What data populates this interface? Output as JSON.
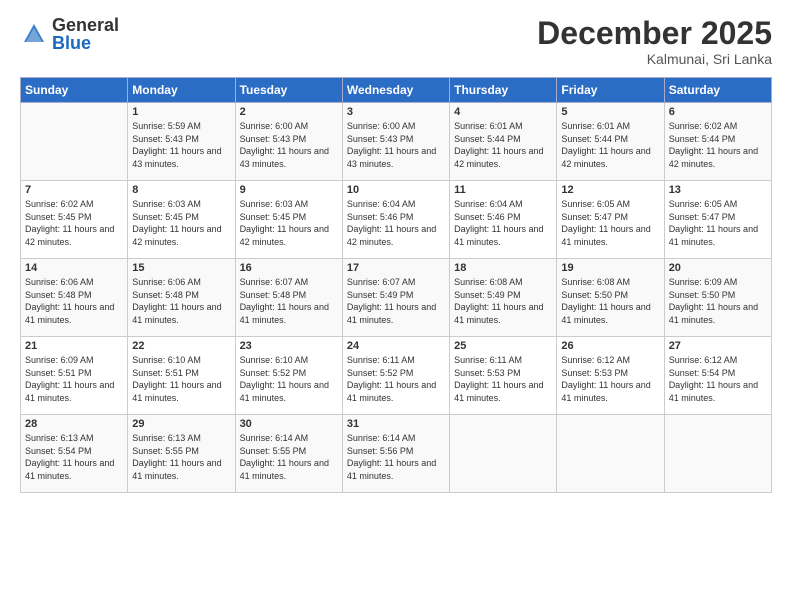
{
  "header": {
    "logo_general": "General",
    "logo_blue": "Blue",
    "month_title": "December 2025",
    "location": "Kalmunai, Sri Lanka"
  },
  "days_of_week": [
    "Sunday",
    "Monday",
    "Tuesday",
    "Wednesday",
    "Thursday",
    "Friday",
    "Saturday"
  ],
  "weeks": [
    [
      {
        "day": "",
        "sunrise": "",
        "sunset": "",
        "daylight": ""
      },
      {
        "day": "1",
        "sunrise": "Sunrise: 5:59 AM",
        "sunset": "Sunset: 5:43 PM",
        "daylight": "Daylight: 11 hours and 43 minutes."
      },
      {
        "day": "2",
        "sunrise": "Sunrise: 6:00 AM",
        "sunset": "Sunset: 5:43 PM",
        "daylight": "Daylight: 11 hours and 43 minutes."
      },
      {
        "day": "3",
        "sunrise": "Sunrise: 6:00 AM",
        "sunset": "Sunset: 5:43 PM",
        "daylight": "Daylight: 11 hours and 43 minutes."
      },
      {
        "day": "4",
        "sunrise": "Sunrise: 6:01 AM",
        "sunset": "Sunset: 5:44 PM",
        "daylight": "Daylight: 11 hours and 42 minutes."
      },
      {
        "day": "5",
        "sunrise": "Sunrise: 6:01 AM",
        "sunset": "Sunset: 5:44 PM",
        "daylight": "Daylight: 11 hours and 42 minutes."
      },
      {
        "day": "6",
        "sunrise": "Sunrise: 6:02 AM",
        "sunset": "Sunset: 5:44 PM",
        "daylight": "Daylight: 11 hours and 42 minutes."
      }
    ],
    [
      {
        "day": "7",
        "sunrise": "Sunrise: 6:02 AM",
        "sunset": "Sunset: 5:45 PM",
        "daylight": "Daylight: 11 hours and 42 minutes."
      },
      {
        "day": "8",
        "sunrise": "Sunrise: 6:03 AM",
        "sunset": "Sunset: 5:45 PM",
        "daylight": "Daylight: 11 hours and 42 minutes."
      },
      {
        "day": "9",
        "sunrise": "Sunrise: 6:03 AM",
        "sunset": "Sunset: 5:45 PM",
        "daylight": "Daylight: 11 hours and 42 minutes."
      },
      {
        "day": "10",
        "sunrise": "Sunrise: 6:04 AM",
        "sunset": "Sunset: 5:46 PM",
        "daylight": "Daylight: 11 hours and 42 minutes."
      },
      {
        "day": "11",
        "sunrise": "Sunrise: 6:04 AM",
        "sunset": "Sunset: 5:46 PM",
        "daylight": "Daylight: 11 hours and 41 minutes."
      },
      {
        "day": "12",
        "sunrise": "Sunrise: 6:05 AM",
        "sunset": "Sunset: 5:47 PM",
        "daylight": "Daylight: 11 hours and 41 minutes."
      },
      {
        "day": "13",
        "sunrise": "Sunrise: 6:05 AM",
        "sunset": "Sunset: 5:47 PM",
        "daylight": "Daylight: 11 hours and 41 minutes."
      }
    ],
    [
      {
        "day": "14",
        "sunrise": "Sunrise: 6:06 AM",
        "sunset": "Sunset: 5:48 PM",
        "daylight": "Daylight: 11 hours and 41 minutes."
      },
      {
        "day": "15",
        "sunrise": "Sunrise: 6:06 AM",
        "sunset": "Sunset: 5:48 PM",
        "daylight": "Daylight: 11 hours and 41 minutes."
      },
      {
        "day": "16",
        "sunrise": "Sunrise: 6:07 AM",
        "sunset": "Sunset: 5:48 PM",
        "daylight": "Daylight: 11 hours and 41 minutes."
      },
      {
        "day": "17",
        "sunrise": "Sunrise: 6:07 AM",
        "sunset": "Sunset: 5:49 PM",
        "daylight": "Daylight: 11 hours and 41 minutes."
      },
      {
        "day": "18",
        "sunrise": "Sunrise: 6:08 AM",
        "sunset": "Sunset: 5:49 PM",
        "daylight": "Daylight: 11 hours and 41 minutes."
      },
      {
        "day": "19",
        "sunrise": "Sunrise: 6:08 AM",
        "sunset": "Sunset: 5:50 PM",
        "daylight": "Daylight: 11 hours and 41 minutes."
      },
      {
        "day": "20",
        "sunrise": "Sunrise: 6:09 AM",
        "sunset": "Sunset: 5:50 PM",
        "daylight": "Daylight: 11 hours and 41 minutes."
      }
    ],
    [
      {
        "day": "21",
        "sunrise": "Sunrise: 6:09 AM",
        "sunset": "Sunset: 5:51 PM",
        "daylight": "Daylight: 11 hours and 41 minutes."
      },
      {
        "day": "22",
        "sunrise": "Sunrise: 6:10 AM",
        "sunset": "Sunset: 5:51 PM",
        "daylight": "Daylight: 11 hours and 41 minutes."
      },
      {
        "day": "23",
        "sunrise": "Sunrise: 6:10 AM",
        "sunset": "Sunset: 5:52 PM",
        "daylight": "Daylight: 11 hours and 41 minutes."
      },
      {
        "day": "24",
        "sunrise": "Sunrise: 6:11 AM",
        "sunset": "Sunset: 5:52 PM",
        "daylight": "Daylight: 11 hours and 41 minutes."
      },
      {
        "day": "25",
        "sunrise": "Sunrise: 6:11 AM",
        "sunset": "Sunset: 5:53 PM",
        "daylight": "Daylight: 11 hours and 41 minutes."
      },
      {
        "day": "26",
        "sunrise": "Sunrise: 6:12 AM",
        "sunset": "Sunset: 5:53 PM",
        "daylight": "Daylight: 11 hours and 41 minutes."
      },
      {
        "day": "27",
        "sunrise": "Sunrise: 6:12 AM",
        "sunset": "Sunset: 5:54 PM",
        "daylight": "Daylight: 11 hours and 41 minutes."
      }
    ],
    [
      {
        "day": "28",
        "sunrise": "Sunrise: 6:13 AM",
        "sunset": "Sunset: 5:54 PM",
        "daylight": "Daylight: 11 hours and 41 minutes."
      },
      {
        "day": "29",
        "sunrise": "Sunrise: 6:13 AM",
        "sunset": "Sunset: 5:55 PM",
        "daylight": "Daylight: 11 hours and 41 minutes."
      },
      {
        "day": "30",
        "sunrise": "Sunrise: 6:14 AM",
        "sunset": "Sunset: 5:55 PM",
        "daylight": "Daylight: 11 hours and 41 minutes."
      },
      {
        "day": "31",
        "sunrise": "Sunrise: 6:14 AM",
        "sunset": "Sunset: 5:56 PM",
        "daylight": "Daylight: 11 hours and 41 minutes."
      },
      {
        "day": "",
        "sunrise": "",
        "sunset": "",
        "daylight": ""
      },
      {
        "day": "",
        "sunrise": "",
        "sunset": "",
        "daylight": ""
      },
      {
        "day": "",
        "sunrise": "",
        "sunset": "",
        "daylight": ""
      }
    ]
  ]
}
